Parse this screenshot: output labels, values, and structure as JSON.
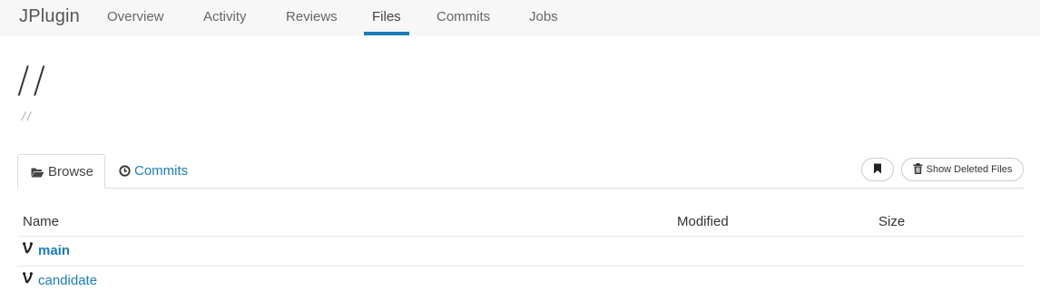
{
  "nav": {
    "brand": "JPlugin",
    "tabs": [
      {
        "label": "Overview"
      },
      {
        "label": "Activity"
      },
      {
        "label": "Reviews"
      },
      {
        "label": "Files"
      },
      {
        "label": "Commits"
      },
      {
        "label": "Jobs"
      }
    ],
    "active_tab": "Files"
  },
  "path": {
    "title": "//",
    "subtitle": "//"
  },
  "subtabs": {
    "browse_label": "Browse",
    "commits_label": "Commits"
  },
  "toolbar": {
    "show_deleted_label": "Show Deleted Files"
  },
  "table": {
    "columns": [
      "Name",
      "Modified",
      "Size"
    ],
    "rows": [
      {
        "name": "main",
        "icon": "branch-icon"
      },
      {
        "name": "candidate",
        "icon": "branch-icon"
      }
    ]
  },
  "colors": {
    "accent": "#1b7db8",
    "nav_bg": "#f7f7f7"
  }
}
